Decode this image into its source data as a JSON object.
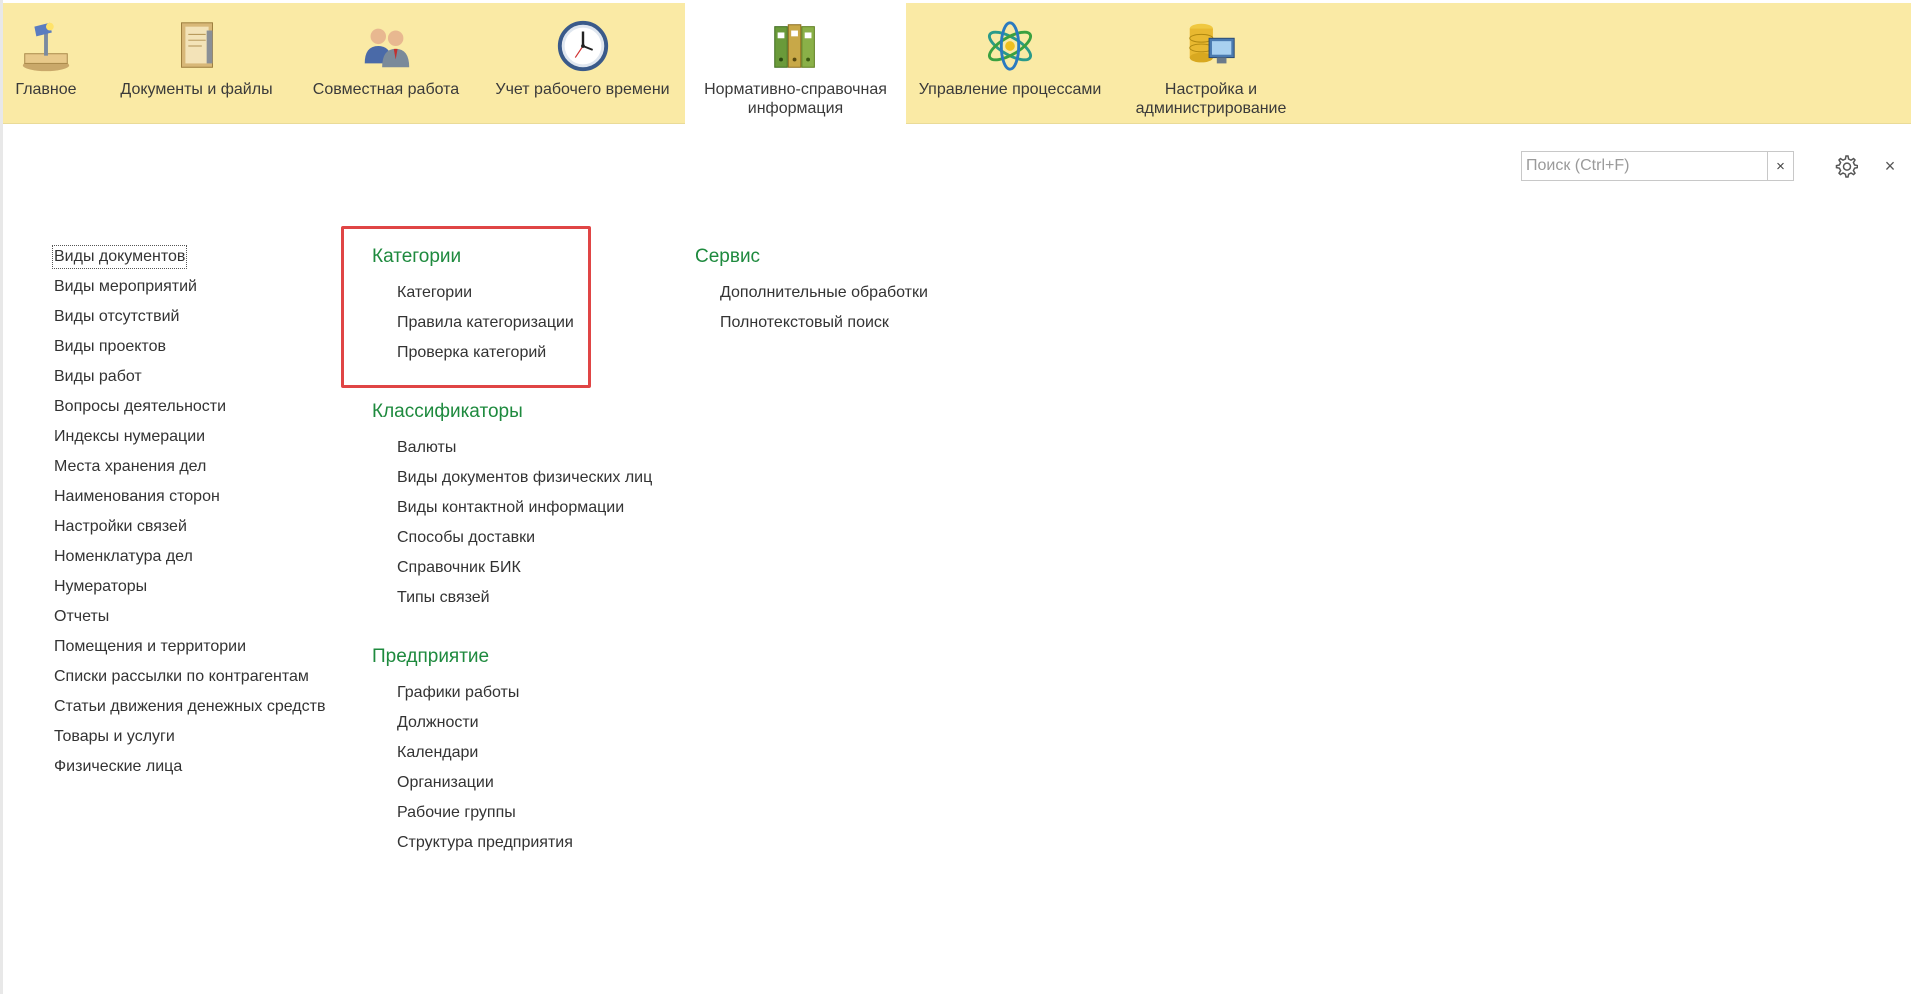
{
  "sections": [
    {
      "label": "Главное",
      "icon": "desk-lamp-icon"
    },
    {
      "label": "Документы и файлы",
      "icon": "documents-binder-icon"
    },
    {
      "label": "Совместная работа",
      "icon": "people-icon"
    },
    {
      "label": "Учет рабочего времени",
      "icon": "clock-icon"
    },
    {
      "label": "Нормативно-справочная\nинформация",
      "icon": "folders-icon"
    },
    {
      "label": "Управление процессами",
      "icon": "atom-process-icon"
    },
    {
      "label": "Настройка и\nадминистрирование",
      "icon": "database-computer-icon"
    }
  ],
  "active_section": 4,
  "search": {
    "placeholder": "Поиск (Ctrl+F)",
    "clear": "×"
  },
  "close": "×",
  "left_column": [
    "Виды документов",
    "Виды мероприятий",
    "Виды отсутствий",
    "Виды проектов",
    "Виды работ",
    "Вопросы деятельности",
    "Индексы нумерации",
    "Места хранения дел",
    "Наименования сторон",
    "Настройки связей",
    "Номенклатура дел",
    "Нумераторы",
    "Отчеты",
    "Помещения и территории",
    "Списки рассылки по контрагентам",
    "Статьи движения денежных средств",
    "Товары и услуги",
    "Физические лица"
  ],
  "groups": {
    "categories": {
      "title": "Категории",
      "items": [
        "Категории",
        "Правила категоризации",
        "Проверка категорий"
      ]
    },
    "classifiers": {
      "title": "Классификаторы",
      "items": [
        "Валюты",
        "Виды документов физических лиц",
        "Виды контактной информации",
        "Способы доставки",
        "Справочник БИК",
        "Типы связей"
      ]
    },
    "enterprise": {
      "title": "Предприятие",
      "items": [
        "Графики работы",
        "Должности",
        "Календари",
        "Организации",
        "Рабочие группы",
        "Структура предприятия"
      ]
    },
    "service": {
      "title": "Сервис",
      "items": [
        "Дополнительные обработки",
        "Полнотекстовый поиск"
      ]
    }
  },
  "colors": {
    "topbar": "#faeaa5",
    "group_title": "#1e8a3e",
    "highlight": "#e04545"
  }
}
